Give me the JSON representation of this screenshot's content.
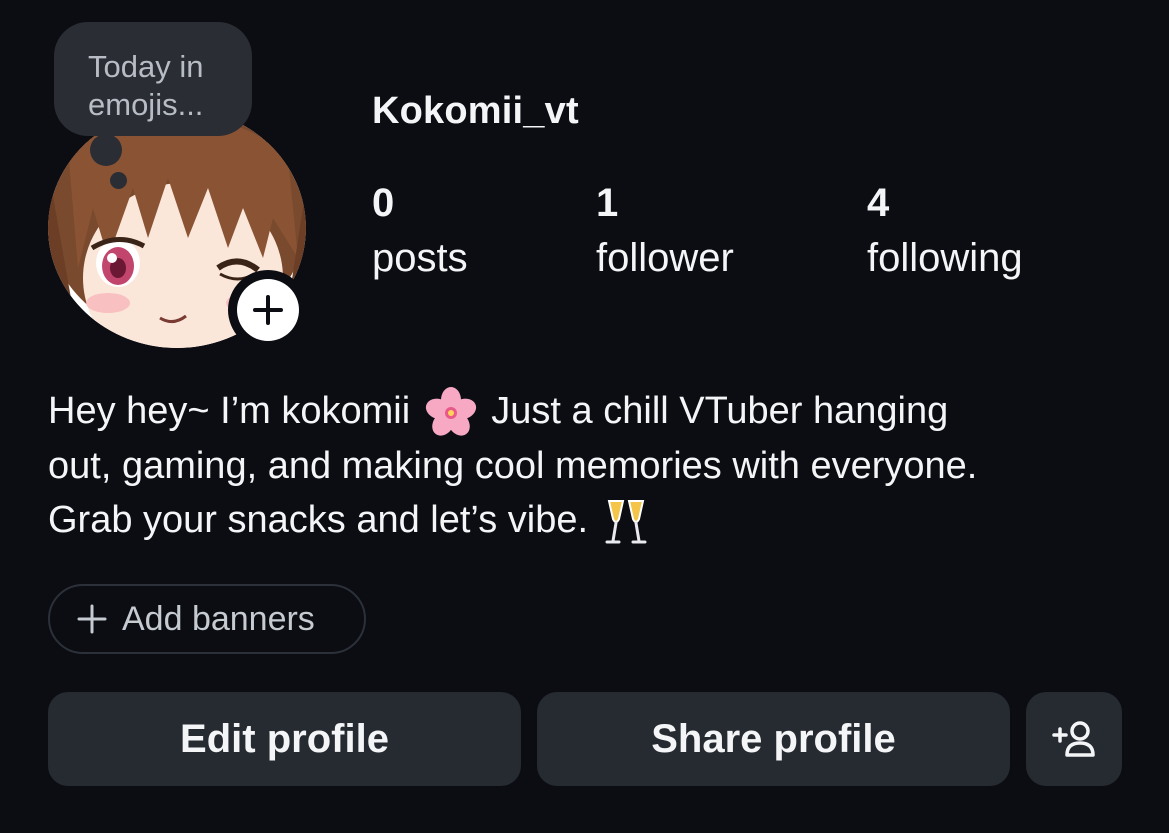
{
  "note": {
    "text_line1": "Today in",
    "text_line2": "emojis..."
  },
  "profile": {
    "username": "Kokomii_vt",
    "stats": [
      {
        "value": "0",
        "label": "posts"
      },
      {
        "value": "1",
        "label": "follower"
      },
      {
        "value": "4",
        "label": "following"
      }
    ],
    "bio": {
      "line1_a": "Hey hey~ I’m kokomii",
      "line1_b": "Just a chill VTuber hanging",
      "line2": "out, gaming, and making cool memories with everyone.",
      "line3": "Grab your snacks and let’s vibe."
    }
  },
  "banners": {
    "label": "Add banners"
  },
  "actions": {
    "edit_label": "Edit profile",
    "share_label": "Share profile"
  },
  "icons": {
    "add_story": "plus-icon",
    "banners": "plus-icon",
    "add_person": "add-person-icon",
    "bio_emoji_1": "cherry-blossom-icon",
    "bio_emoji_2": "clinking-glasses-icon"
  }
}
